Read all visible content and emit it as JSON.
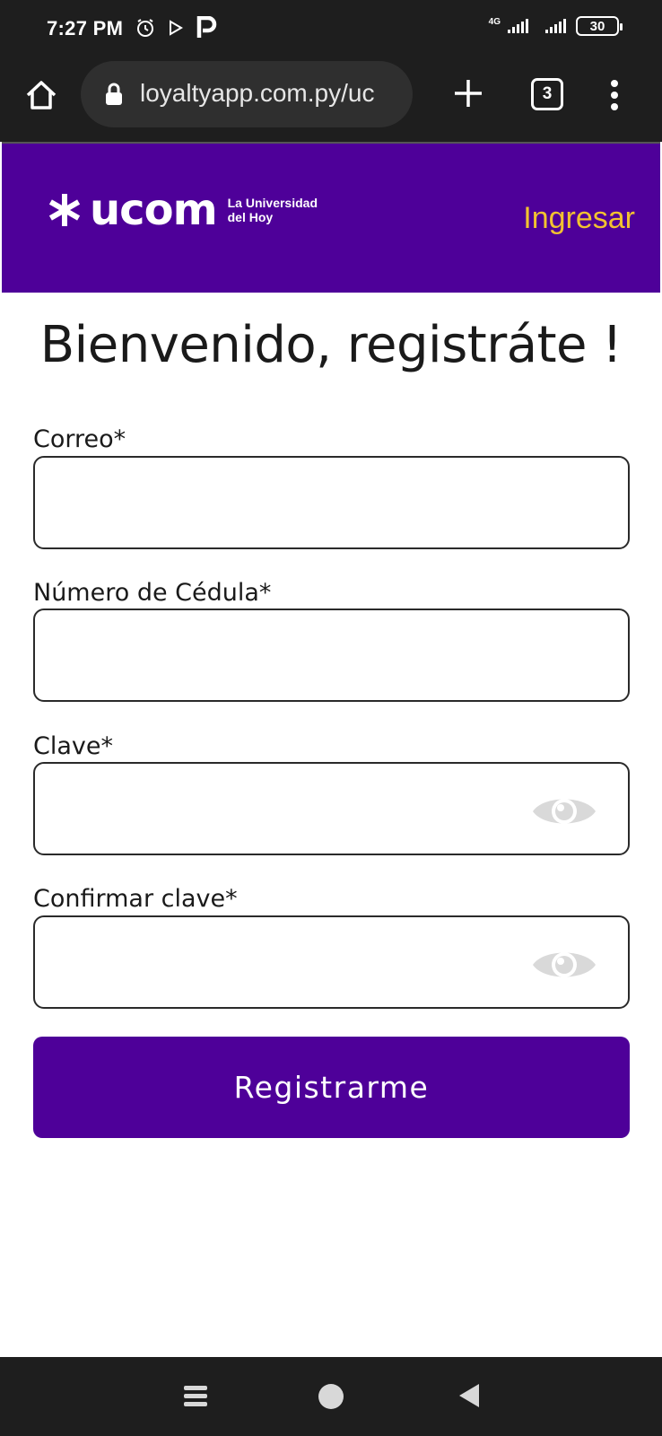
{
  "status_bar": {
    "time": "7:27 PM",
    "network": "4G",
    "battery": "30"
  },
  "browser": {
    "url": "loyaltyapp.com.py/uc",
    "tab_count": "3",
    "icons": [
      "home-icon",
      "lock-icon",
      "plus-icon",
      "tabs-icon",
      "more-vert-icon"
    ]
  },
  "header": {
    "logo_word": "ucom",
    "logo_tagline_line1": "La Universidad",
    "logo_tagline_line2": "del Hoy",
    "login_label": "Ingresar",
    "background_color": "#4e0099",
    "login_color": "#f2c230"
  },
  "form": {
    "title": "Bienvenido, registráte !",
    "fields": [
      {
        "label": "Correo*",
        "value": ""
      },
      {
        "label": "Número de Cédula*",
        "value": ""
      },
      {
        "label": "Clave*",
        "value": "",
        "icon": "eye-icon"
      },
      {
        "label": "Confirmar clave*",
        "value": "",
        "icon": "eye-icon"
      }
    ],
    "submit_label": "Registrarme"
  },
  "nav_bar": {
    "icons": [
      "recents-icon",
      "home-circle-icon",
      "back-icon"
    ]
  }
}
